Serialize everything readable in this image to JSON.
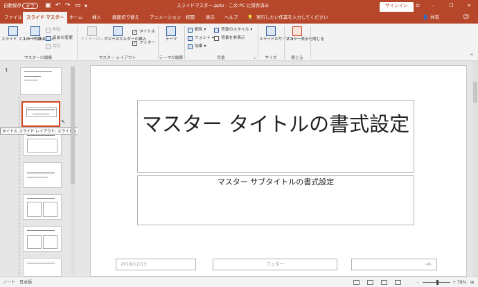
{
  "titlebar": {
    "autosave_label": "自動保存",
    "autosave_state": "オフ",
    "title": "スライドマスター.pptx - この PC に保存済み",
    "signin": "サインイン",
    "colors": {
      "brand": "#b7472a"
    }
  },
  "tabs": [
    {
      "label": "ファイル"
    },
    {
      "label": "スライド マスター",
      "active": true
    },
    {
      "label": "ホーム"
    },
    {
      "label": "挿入"
    },
    {
      "label": "画面切り替え"
    },
    {
      "label": "アニメーション"
    },
    {
      "label": "校閲"
    },
    {
      "label": "表示"
    },
    {
      "label": "ヘルプ"
    }
  ],
  "search": {
    "placeholder": "実行したい作業を入力してください",
    "icon": "lightbulb-icon"
  },
  "share": {
    "label": "共有",
    "icon": "person-icon"
  },
  "ribbon": {
    "group_edit_master": {
      "label": "マスターの編集",
      "insert_master": "スライド マスターの挿入",
      "insert_layout": "レイアウトの挿入",
      "delete": "削除",
      "rename": "名前の変更",
      "preserve": "保存"
    },
    "group_master_layout": {
      "label": "マスター レイアウト",
      "master_layout": "マスターのレイアウト",
      "insert_placeholder": "プレースホルダーの挿入",
      "title_check": "タイトル",
      "footer_check": "フッター",
      "title_checked": true,
      "footer_checked": true
    },
    "group_theme": {
      "label": "テーマの編集",
      "themes": "テーマ"
    },
    "group_background": {
      "label": "背景",
      "colors": "配色",
      "fonts": "フォント",
      "effects": "効果",
      "bg_styles": "背景のスタイル",
      "hide_bg": "背景を非表示"
    },
    "group_size": {
      "label": "サイズ",
      "slide_size": "スライドのサイズ"
    },
    "group_close": {
      "label": "閉じる",
      "close_master": "マスター表示を閉じる"
    }
  },
  "thumbnails": {
    "master_number": "1",
    "tooltip": "タイトル スライド レイアウト: スライド 1 で使用される"
  },
  "slide": {
    "title": "マスター タイトルの書式設定",
    "subtitle": "マスター サブタイトルの書式設定",
    "date": "2018/12/13",
    "footer": "フッター",
    "page": "‹#›"
  },
  "statusbar": {
    "view": "ノート",
    "language": "日本語",
    "zoom": "78%",
    "zoom_minus": "-",
    "zoom_plus": "+"
  }
}
